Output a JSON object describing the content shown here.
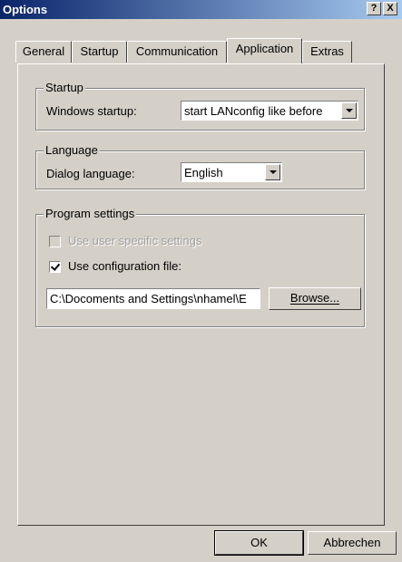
{
  "window": {
    "title": "Options"
  },
  "titlebar": {
    "help_label": "?",
    "close_label": "X"
  },
  "tabs": [
    {
      "label": "General"
    },
    {
      "label": "Startup"
    },
    {
      "label": "Communication"
    },
    {
      "label": "Application",
      "active": true
    },
    {
      "label": "Extras"
    }
  ],
  "startup_group": {
    "legend": "Startup",
    "windows_startup_label": "Windows startup:",
    "windows_startup_value": "start LANconfig like before"
  },
  "language_group": {
    "legend": "Language",
    "dialog_language_label": "Dialog language:",
    "dialog_language_value": "English"
  },
  "program_group": {
    "legend": "Program settings",
    "user_specific_label": "Use user specific settings",
    "user_specific_checked": false,
    "user_specific_enabled": false,
    "config_file_label": "Use configuration file:",
    "config_file_checked": true,
    "config_path": "C:\\Docoments and Settings\\nhamel\\E",
    "browse_label": "Browse..."
  },
  "footer": {
    "ok_label": "OK",
    "cancel_label": "Abbrechen"
  }
}
